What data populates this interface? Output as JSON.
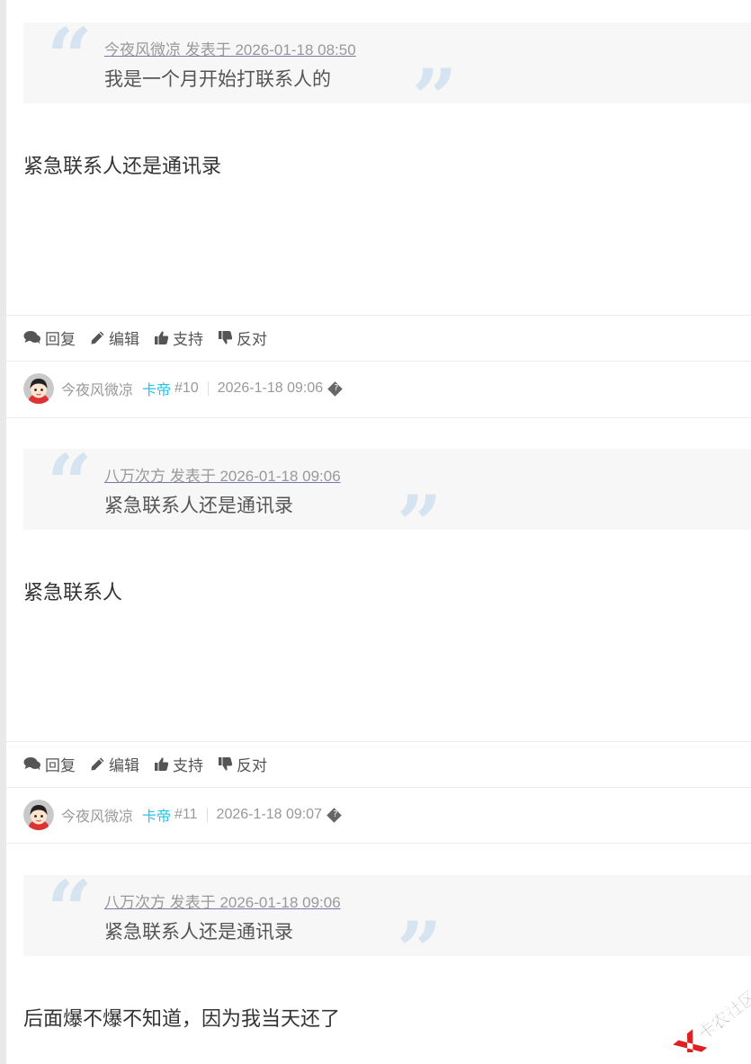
{
  "posts": [
    {
      "quote": {
        "meta": "今夜风微凉 发表于 2026-01-18 08:50",
        "text": "我是一个月开始打联系人的"
      },
      "body": "紧急联系人还是通讯录",
      "actions": {
        "reply": "回复",
        "edit": "编辑",
        "support": "支持",
        "oppose": "反对"
      },
      "author": {
        "name": "今夜风微凉",
        "rank": "卡帝",
        "floor": "#10",
        "time": "2026-1-18 09:06",
        "more": "?"
      }
    },
    {
      "quote": {
        "meta": "八万次方 发表于 2026-01-18 09:06",
        "text": "紧急联系人还是通讯录"
      },
      "body": "紧急联系人",
      "actions": {
        "reply": "回复",
        "edit": "编辑",
        "support": "支持",
        "oppose": "反对"
      },
      "author": {
        "name": "今夜风微凉",
        "rank": "卡帝",
        "floor": "#11",
        "time": "2026-1-18 09:07",
        "more": "?"
      }
    },
    {
      "quote": {
        "meta": "八万次方 发表于 2026-01-18 09:06",
        "text": "紧急联系人还是通讯录"
      },
      "body": "后面爆不爆不知道，因为我当天还了"
    }
  ],
  "watermark": {
    "text": "卡农社区"
  },
  "colors": {
    "rank": "#20c4e8",
    "quote_mark": "#d5e4f0",
    "quote_bg": "#f7f7f7"
  }
}
